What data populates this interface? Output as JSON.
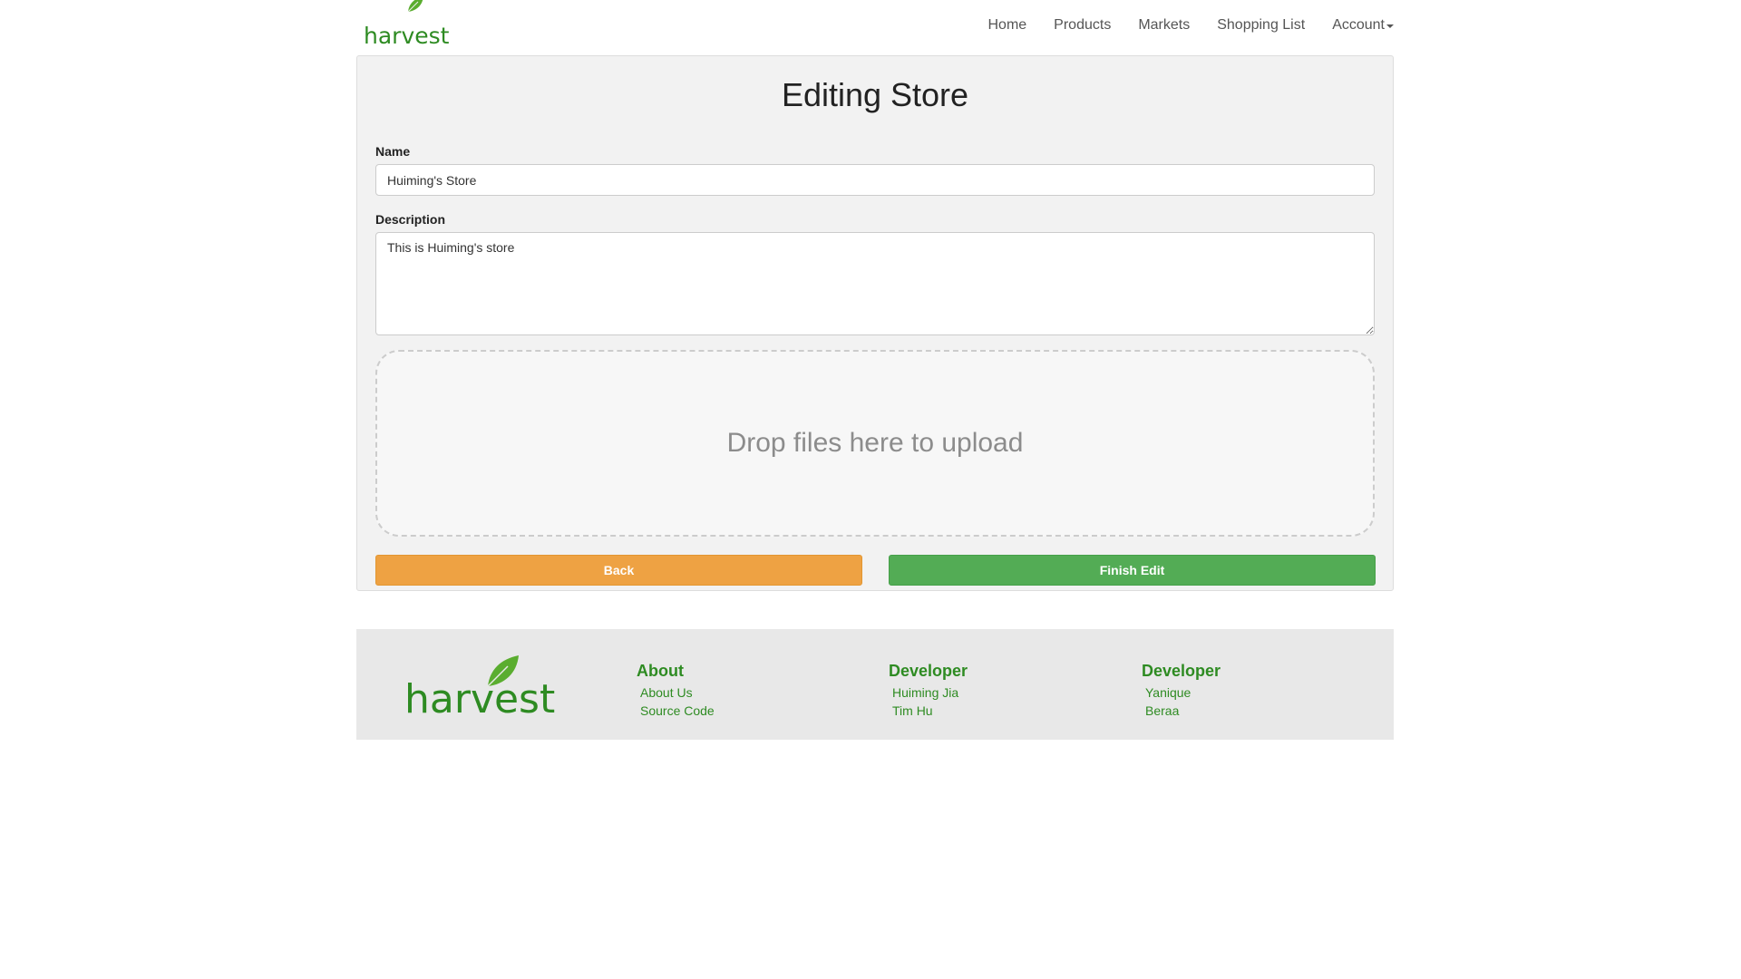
{
  "header": {
    "brand": "harvest",
    "nav": [
      {
        "label": "Home"
      },
      {
        "label": "Products"
      },
      {
        "label": "Markets"
      },
      {
        "label": "Shopping List"
      },
      {
        "label": "Account"
      }
    ]
  },
  "form": {
    "title": "Editing Store",
    "name_label": "Name",
    "name_value": "Huiming's Store",
    "description_label": "Description",
    "description_value": "This is Huiming's store",
    "dropzone_text": "Drop files here to upload",
    "back_label": "Back",
    "finish_label": "Finish Edit"
  },
  "footer": {
    "brand": "harvest",
    "columns": [
      {
        "heading": "About",
        "links": [
          "About Us",
          "Source Code"
        ]
      },
      {
        "heading": "Developer",
        "links": [
          "Huiming Jia",
          "Tim Hu"
        ]
      },
      {
        "heading": "Developer",
        "links": [
          "Yanique",
          "Beraa"
        ]
      }
    ]
  },
  "colors": {
    "brand_green": "#2e8b22",
    "leaf_green": "#5aad2f",
    "back_orange": "#eea243",
    "finish_green": "#53ac55"
  }
}
